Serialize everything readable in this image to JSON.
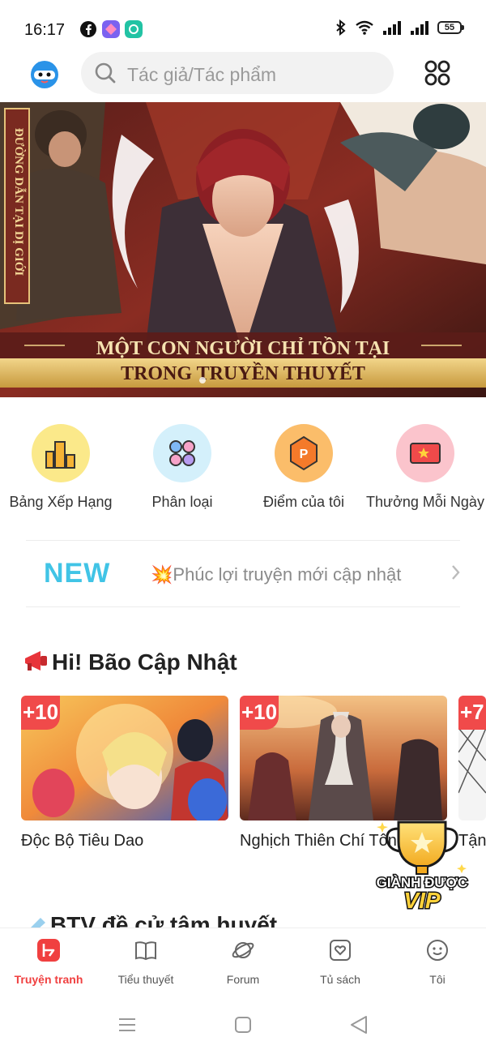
{
  "status_bar": {
    "time": "16:17",
    "battery": "55",
    "icons": [
      "facebook-icon",
      "app-icon",
      "chat-app-icon",
      "bluetooth-icon",
      "wifi-icon",
      "signal-icon",
      "signal-icon",
      "battery-icon"
    ]
  },
  "search": {
    "placeholder": "Tác giả/Tác phẩm"
  },
  "banner": {
    "side_text": "ĐƯỜNG DẪN TẠI DỊ GIỚI",
    "line1": "MỘT CON NGƯỜI CHỈ TỒN TẠI",
    "line2": "TRONG TRUYỀN THUYẾT"
  },
  "quick_menu": [
    {
      "label": "Bảng Xếp Hạng",
      "icon": "ranking-icon",
      "color": "#fbe98a"
    },
    {
      "label": "Phân loại",
      "icon": "category-icon",
      "color": "#d4f0fb"
    },
    {
      "label": "Điểm của tôi",
      "icon": "points-icon",
      "color": "#fbbd6a"
    },
    {
      "label": "Thưởng Mỗi Ngày",
      "icon": "daily-reward-icon",
      "color": "#fbc4cc"
    }
  ],
  "news": {
    "badge": "NEW",
    "text": "💥Phúc lợi truyện mới cập nhật"
  },
  "section1": {
    "title": "Hi! Bão Cập Nhật",
    "cards": [
      {
        "badge": "+10",
        "title": "Độc Bộ Tiêu Dao"
      },
      {
        "badge": "+10",
        "title": "Nghịch Thiên Chí Tôn"
      },
      {
        "badge": "+7",
        "title": "Tận"
      }
    ]
  },
  "vip": {
    "line1": "GIÀNH ĐƯỢC",
    "line2": "VIP"
  },
  "section2": {
    "title": "BTV đề cử tâm huyết"
  },
  "bottom_nav": [
    {
      "label": "Truyện tranh",
      "icon": "comic-icon",
      "active": true
    },
    {
      "label": "Tiểu thuyết",
      "icon": "book-icon",
      "active": false
    },
    {
      "label": "Forum",
      "icon": "planet-icon",
      "active": false
    },
    {
      "label": "Tủ sách",
      "icon": "bookshelf-icon",
      "active": false
    },
    {
      "label": "Tôi",
      "icon": "smiley-icon",
      "active": false
    }
  ],
  "colors": {
    "accent": "#f04040",
    "new_badge": "#41c4e6",
    "card_badge": "#f04a4a"
  }
}
